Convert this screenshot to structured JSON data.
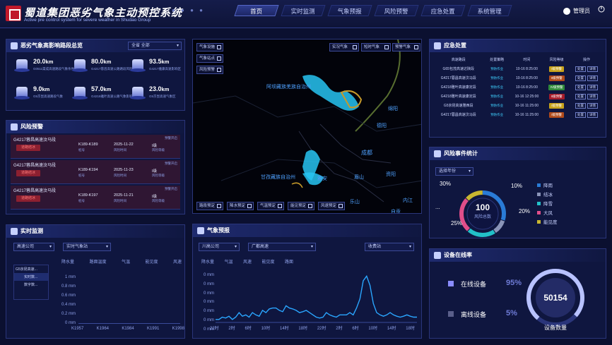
{
  "header": {
    "title": "蜀道集团恶劣气象主动预控系统",
    "subtitle": "Active pre control system for severe weather in Shudao Group",
    "dots": "● ● ● ●",
    "nav": [
      "首页",
      "实时监测",
      "气象预报",
      "风险预警",
      "应急处置",
      "系统管理"
    ],
    "user": "管理员"
  },
  "road_summary": {
    "title": "恶劣气象高影响路段总览",
    "select_label": "全省",
    "select_value": "全部",
    "stats": [
      {
        "value": "20.0",
        "unit": "km",
        "label": "G0511渠成高速路段气象条件"
      },
      {
        "value": "80.0",
        "unit": "km",
        "label": "G4217蓉昌高速公路路段风险"
      },
      {
        "value": "93.5",
        "unit": "km",
        "label": "G4217雅康高速影响区"
      },
      {
        "value": "9.0",
        "unit": "km",
        "label": "G5京昆高速路段气象"
      },
      {
        "value": "57.0",
        "unit": "km",
        "label": "G4218雅叶高速公路气象影响"
      },
      {
        "value": "23.0",
        "unit": "km",
        "label": "G5京昆高速气象区"
      }
    ]
  },
  "risk_warning": {
    "title": "风险预警",
    "rows": [
      {
        "road": "G4217蓉昌高速汶马段",
        "tag": "道路结冰",
        "code": "K189-K189",
        "code_l": "桩号",
        "date": "2025-11-22",
        "date_l": "风险时间",
        "level": "I级",
        "level_l": "风险等级",
        "status": "预警开启",
        "action": "处置"
      },
      {
        "road": "G4217蓉昌高速汶马段",
        "tag": "道路结冰",
        "code": "K189-K194",
        "code_l": "桩号",
        "date": "2025-11-23",
        "date_l": "风险时间",
        "level": "I级",
        "level_l": "风险等级",
        "status": "预警开启",
        "action": "处置"
      },
      {
        "road": "G4217蓉昌高速汶马段",
        "tag": "道路结冰",
        "code": "K189-K197",
        "code_l": "桩号",
        "date": "2025-11-21",
        "date_l": "风险时间",
        "level": "I级",
        "level_l": "风险等级",
        "status": "预警开启",
        "action": "处置"
      }
    ]
  },
  "monitor": {
    "title": "实时监测",
    "sel1": "高速公司",
    "sel2": "实时气象站",
    "tree": [
      "G5京昆高速...",
      "实时数...",
      "数字数..."
    ],
    "cols": [
      "降水量",
      "路面温度",
      "气温",
      "能见度",
      "风速"
    ],
    "yticks": [
      "1 mm",
      "0.8 mm",
      "0.6 mm",
      "0.4 mm",
      "0.2 mm",
      "0 mm"
    ],
    "xticks": [
      "K1957",
      "K1964",
      "K1984",
      "K1991",
      "K1998"
    ]
  },
  "map": {
    "checks_left": [
      "气象设施",
      "气象站点",
      "风险预警"
    ],
    "checks_top": [
      "实况气象",
      "短时气象",
      "预警气象"
    ],
    "checks_bottom": [
      "路段预定",
      "降水预定",
      "气温预定",
      "能见预定",
      "风速预定"
    ],
    "cities": [
      "阿坝藏族羌族自治州",
      "绵阳",
      "德阳",
      "成都",
      "甘孜藏族自治州",
      "雅安",
      "眉山",
      "资阳",
      "乐山",
      "内江",
      "自贡"
    ]
  },
  "forecast": {
    "title": "气象预报",
    "sel1": "川高公司",
    "sel2": "广都高速",
    "sel3": "收费站",
    "cols": [
      "降水量",
      "气温",
      "风速",
      "能见度",
      "路面"
    ],
    "yticks": [
      "0 mm",
      "0 mm",
      "0 mm",
      "0 mm",
      "0 mm",
      "0 mm",
      "0 mm"
    ],
    "xticks": [
      "22时",
      "2时",
      "6时",
      "10时",
      "14时",
      "18时",
      "22时",
      "2时",
      "6时",
      "10时",
      "14时",
      "18时"
    ],
    "series": [
      0.05,
      0.05,
      0.1,
      0.08,
      0.12,
      0.05,
      0.1,
      0.2,
      0.12,
      0.15,
      0.1,
      0.2,
      0.15,
      0.12,
      0.25,
      0.2,
      0.28,
      0.3,
      0.3,
      0.25,
      0.22,
      0.35,
      0.3,
      0.28,
      0.25,
      0.2,
      0.22,
      0.25,
      0.2,
      0.15,
      0.1,
      0.08,
      0.1,
      0.2,
      0.15,
      0.12,
      0.1,
      0.15,
      0.15,
      0.15,
      0.2,
      0.15,
      0.3,
      0.5,
      0.9,
      1.0,
      0.8,
      0.4,
      0.2,
      0.15,
      0.12,
      0.15,
      0.2,
      0.15,
      0.12,
      0.1,
      0.12,
      0.15,
      0.12,
      0.1,
      0.1
    ]
  },
  "emergency": {
    "title": "应急处置",
    "cols": [
      "高速路段",
      "处置策略",
      "时间",
      "风险等级",
      "操作"
    ],
    "rows": [
      {
        "road": "G65包茂高速达陕段",
        "plan": "预防作业",
        "time": "10-16 8:25:00",
        "level": "I级预警",
        "color": "#c7a21a",
        "ops": [
          "处置",
          "详情"
        ]
      },
      {
        "road": "G4217蓉昌高速汶马段",
        "plan": "预防作业",
        "time": "10-16 8:25:00",
        "level": "II级预警",
        "color": "#b04a1a",
        "ops": [
          "处置",
          "详情"
        ]
      },
      {
        "road": "G4218雅叶高速康定段",
        "plan": "预防作业",
        "time": "10-16 8:25:00",
        "level": "IV级预警",
        "color": "#2f8a3a",
        "ops": [
          "处置",
          "详情"
        ]
      },
      {
        "road": "G4218雅叶高速康定段",
        "plan": "预防作业",
        "time": "10-16 12:25:00",
        "level": "II级预警",
        "color": "#a51b2a",
        "ops": [
          "处置",
          "详情"
        ]
      },
      {
        "road": "G5京昆高速雅西段",
        "plan": "预防作业",
        "time": "10-16 11:25:00",
        "level": "I级预警",
        "color": "#c7a21a",
        "ops": [
          "处置",
          "详情"
        ]
      },
      {
        "road": "G4217蓉昌高速汶马段",
        "plan": "预防作业",
        "time": "10-16 11:25:00",
        "level": "I级预警",
        "color": "#b04a1a",
        "ops": [
          "处置",
          "详情"
        ]
      }
    ]
  },
  "risk_stats": {
    "title": "风险事件统计",
    "select": "选择年份",
    "total": "100",
    "total_label": "风险总数",
    "pct": [
      "30%",
      "10%",
      "20%",
      "25%",
      "..."
    ],
    "legend": [
      {
        "name": "降雨",
        "color": "#2a7bd6"
      },
      {
        "name": "结冰",
        "color": "#8a94b8"
      },
      {
        "name": "降雪",
        "color": "#22c0c8"
      },
      {
        "name": "大风",
        "color": "#e04e8a"
      },
      {
        "name": "能见度",
        "color": "#c8b630"
      }
    ]
  },
  "devices": {
    "title": "设备在线率",
    "online_label": "在线设备",
    "online_pct": "95%",
    "offline_label": "离线设备",
    "offline_pct": "5%",
    "count": "50154",
    "count_label": "设备数量"
  }
}
